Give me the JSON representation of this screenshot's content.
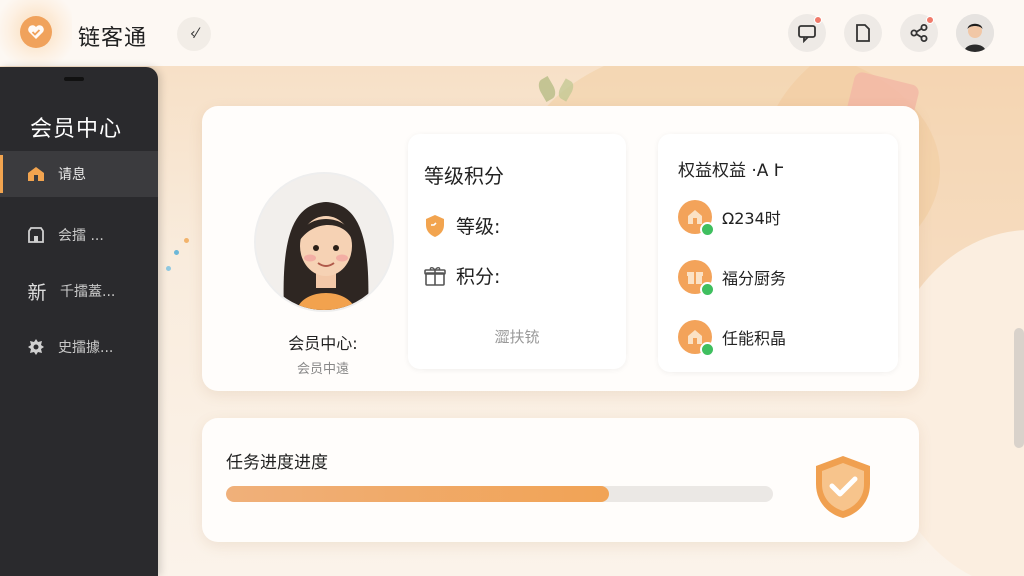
{
  "app": {
    "brand": "链客通"
  },
  "topbar": {
    "back_glyph": "‹⁄",
    "icons": [
      "message-icon",
      "document-icon",
      "share-icon",
      "user-avatar"
    ]
  },
  "sidebar": {
    "title": "会员中心",
    "items": [
      {
        "label": "请息",
        "icon": "house-icon",
        "active": true
      },
      {
        "label": "会擂 ...",
        "icon": "storefront-icon",
        "active": false
      },
      {
        "label": "千擂蓋...",
        "icon": "new-badge-icon",
        "icon_text": "新",
        "active": false
      },
      {
        "label": "史擂據...",
        "icon": "gear-icon",
        "active": false
      }
    ]
  },
  "profile": {
    "name": "会员中心:",
    "subtitle": "会员中遠"
  },
  "points": {
    "title": "等级积分",
    "level_label": "等级:",
    "points_label": "积分:",
    "hint": "澀扶铳"
  },
  "rights": {
    "title": "权益权益 ·A Ւ",
    "items": [
      {
        "label": "Ω234时",
        "icon": "house-badge-icon"
      },
      {
        "label": "福分厨务",
        "icon": "gift-badge-icon"
      },
      {
        "label": "任能积晶",
        "icon": "home-badge-icon"
      }
    ]
  },
  "task": {
    "title": "任务进度进度",
    "progress": 0.7
  },
  "colors": {
    "accent": "#f2a44f",
    "sidebar_bg": "#2a2a2d",
    "check_green": "#3fbf5f"
  }
}
